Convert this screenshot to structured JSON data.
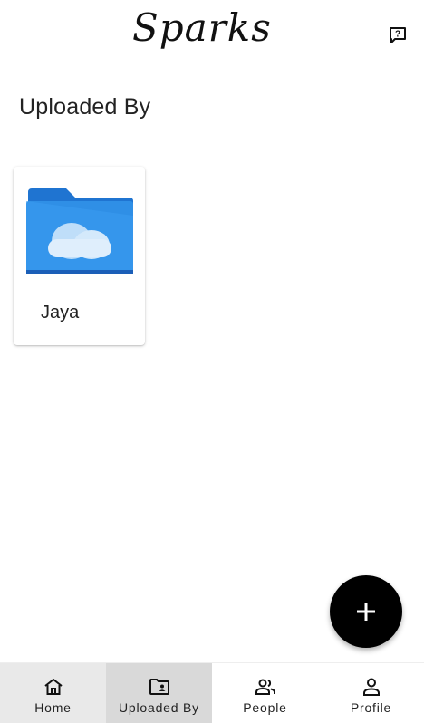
{
  "header": {
    "logo": "Sparks"
  },
  "page": {
    "title": "Uploaded By"
  },
  "folders": [
    {
      "label": "Jaya"
    }
  ],
  "bottom_nav": {
    "items": [
      {
        "label": "Home",
        "icon": "home-icon"
      },
      {
        "label": "Uploaded By",
        "icon": "folder-shared-icon",
        "active": true
      },
      {
        "label": "People",
        "icon": "people-icon"
      },
      {
        "label": "Profile",
        "icon": "person-icon"
      }
    ]
  },
  "colors": {
    "folder_blue": "#2f8fe6",
    "folder_tab": "#1f74d1",
    "nav_active_bg": "#d9d9d9",
    "fab_bg": "#000000"
  }
}
